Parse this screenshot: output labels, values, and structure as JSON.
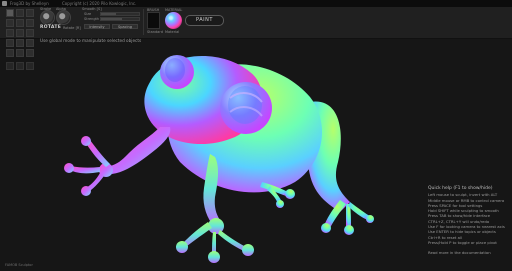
{
  "titlebar": {
    "app_title": "Frog3D by Shelleyn",
    "copyright": "Copyright (c) 2020 Pilo Kowlogic, Inc."
  },
  "toolbar": {
    "brush_labels": [
      "Stroke",
      "Alpha"
    ],
    "mode_label": "ROTATE",
    "mode_hint": "Rotate [R]",
    "smooth_label": "Smooth [S]",
    "options": [
      "Size",
      "Strength",
      "Intensity",
      "Spacing"
    ],
    "brush_section": "BRUSH",
    "brush_name": "Standard",
    "material_section": "MATERIAL",
    "material_name": "Material",
    "paint_button": "PAINT"
  },
  "viewport": {
    "hint": "Use global mode to manipulate selected objects"
  },
  "help": {
    "title": "Quick help (F1 to show/hide)",
    "lines": [
      "Left mouse to sculpt, invert with ALT",
      "Middle mouse or RMB to control camera",
      "Press SPACE for tool settings",
      "Hold SHIFT while sculpting to smooth",
      "Press TAB to show/hide interface",
      "CTRL+Z, CTRL+Y will undo/redo",
      "Use F for looking camera to nearest axis",
      "Use ENTER to hide topics or objects",
      "Ctrl+R to reset all",
      "Press/Hold P to toggle or place pivot",
      "",
      "Read more in the documentation"
    ]
  },
  "footer": {
    "text": "FAMOB Sculptor"
  },
  "colors": {
    "background": "#161616",
    "toolbar": "#202020",
    "accent": "#cfcfcf"
  }
}
